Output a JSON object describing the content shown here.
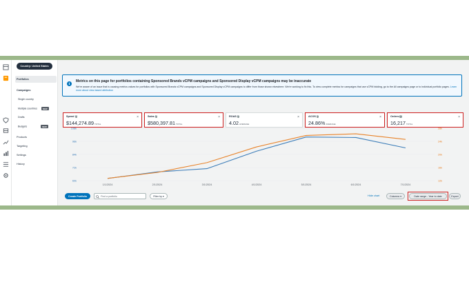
{
  "nav": {
    "country_button": "Country: United States",
    "items": [
      {
        "label": "Portfolios"
      },
      {
        "label": "Campaigns"
      },
      {
        "label": "Single country"
      },
      {
        "label": "Multiple countries",
        "badge": "NEW"
      },
      {
        "label": "Drafts"
      },
      {
        "label": "Budgets",
        "badge": "NEW"
      },
      {
        "label": "Products"
      },
      {
        "label": "Targeting"
      },
      {
        "label": "Settings"
      },
      {
        "label": "History"
      }
    ]
  },
  "banner": {
    "title": "Metrics on this page for portfolios containing Sponsored Brands vCPM campaigns and Sponsored Display vCPM campaigns may be inaccurate",
    "text": "We're aware of an issue that is causing metrics values for portfolios with Sponsored Brands vCPM campaigns and Sponsored Display vCPM campaigns to differ from those shown elsewhere. We're working to fix this. To view complete metrics for campaigns that use vCPM bidding, go to the All campaigns page or to individual portfolio pages.",
    "link": "Learn more about view-based attribution"
  },
  "metrics": [
    {
      "label": "Spend",
      "value": "$144,274.89",
      "sub": "TOTAL",
      "highlighted": true
    },
    {
      "label": "Sales",
      "value": "$580,397.81",
      "sub": "TOTAL",
      "highlighted": true
    },
    {
      "label": "ROAS",
      "value": "4.02",
      "sub": "AVERAGE",
      "highlighted": false
    },
    {
      "label": "ACOS",
      "value": "24.86%",
      "sub": "AVERAGE",
      "highlighted": true
    },
    {
      "label": "Orders",
      "value": "16,217",
      "sub": "TOTAL",
      "highlighted": true
    }
  ],
  "chart_data": {
    "type": "line",
    "x": [
      "1/1/2024",
      "2/1/2024",
      "3/1/2024",
      "4/1/2024",
      "5/1/2024",
      "6/1/2024",
      "7/1/2024"
    ],
    "y_left_ticks": [
      "60k",
      "72k",
      "84k",
      "96k",
      "108k"
    ],
    "y_right_ticks": [
      "12k",
      "16k",
      "20k",
      "24k",
      "28k"
    ],
    "ylim_left": [
      60000,
      108000
    ],
    "ylim_right": [
      12000,
      28000
    ],
    "series": [
      {
        "axis": "left",
        "color": "#3b7cb8",
        "values": [
          62000,
          68000,
          71000,
          87000,
          100000,
          99500,
          90000
        ]
      },
      {
        "axis": "right",
        "color": "#e8832a",
        "values": [
          12700,
          14500,
          17500,
          22300,
          25800,
          26300,
          24600
        ]
      }
    ],
    "left_axis_color": "#3b7cb8",
    "right_axis_color": "#e8832a"
  },
  "toolbar": {
    "create": "Create Portfolio",
    "search_placeholder": "Find a portfolio",
    "filter": "Filter by",
    "hide_chart": "Hide chart",
    "columns": "Columns",
    "date_range": "Date range - Year to date",
    "export": "Export"
  }
}
